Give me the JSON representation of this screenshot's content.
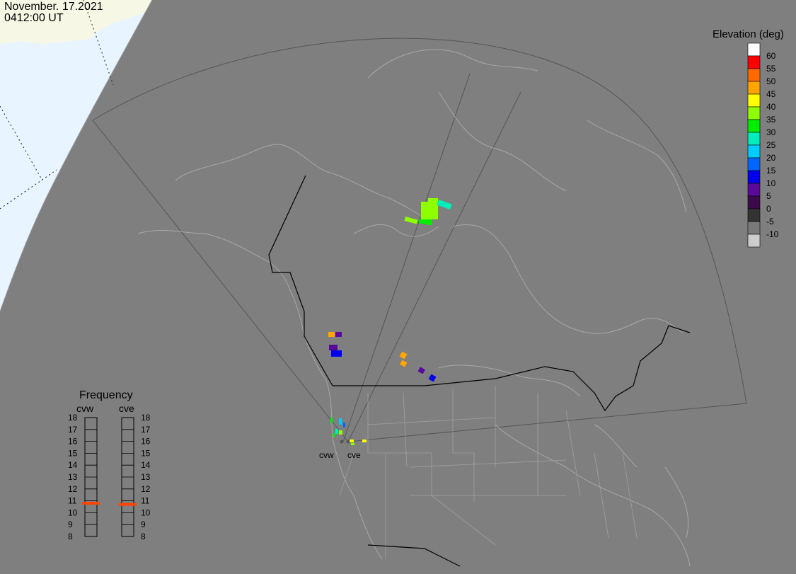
{
  "header": {
    "date": "November. 17.2021",
    "time": "0412:00 UT"
  },
  "elevation_legend": {
    "title": "Elevation (deg)",
    "bins": [
      {
        "label": "60",
        "color": "#ffffff"
      },
      {
        "label": "55",
        "color": "#ff0000"
      },
      {
        "label": "50",
        "color": "#ff6a00"
      },
      {
        "label": "45",
        "color": "#ffa500"
      },
      {
        "label": "40",
        "color": "#ffff00"
      },
      {
        "label": "35",
        "color": "#8fff00"
      },
      {
        "label": "30",
        "color": "#00ee00"
      },
      {
        "label": "25",
        "color": "#00eebb"
      },
      {
        "label": "20",
        "color": "#00ccff"
      },
      {
        "label": "15",
        "color": "#0066ff"
      },
      {
        "label": "10",
        "color": "#0000ee"
      },
      {
        "label": "5",
        "color": "#5a0a9a"
      },
      {
        "label": "0",
        "color": "#3a0a4a"
      },
      {
        "label": "-5",
        "color": "#333333"
      },
      {
        "label": "-10",
        "color": "#7a7a7a"
      },
      {
        "label": "",
        "color": "#cccccc"
      }
    ]
  },
  "frequency_panel": {
    "title": "Frequency",
    "radars": [
      {
        "name": "cvw",
        "value_mhz": 10.8
      },
      {
        "name": "cve",
        "value_mhz": 10.7
      }
    ],
    "scale": [
      "18",
      "17",
      "16",
      "15",
      "14",
      "13",
      "12",
      "11",
      "10",
      "9",
      "8"
    ],
    "indicator_color": "#ff4400"
  },
  "radar_sites": [
    {
      "name": "cvw"
    },
    {
      "name": "cve"
    }
  ]
}
